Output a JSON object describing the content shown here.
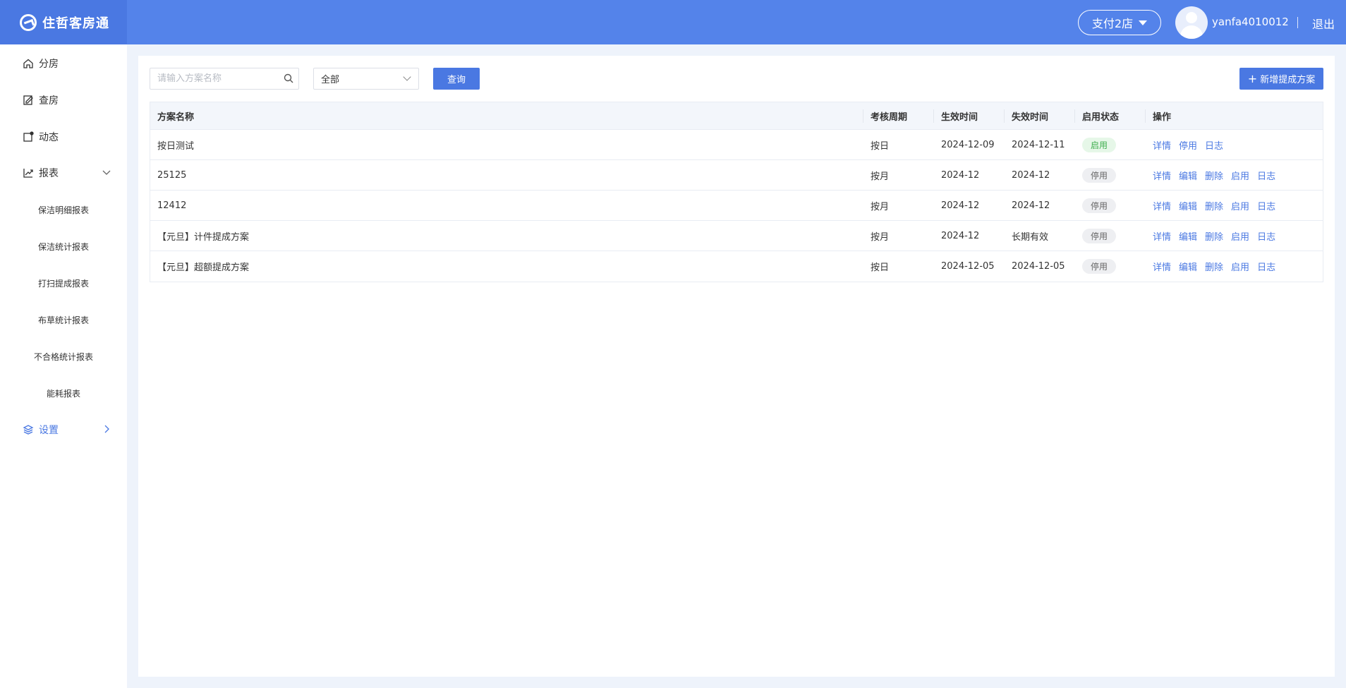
{
  "app": {
    "title": "住哲客房通"
  },
  "header": {
    "store": "支付2店",
    "username": "yanfa4010012",
    "logout": "退出"
  },
  "sidebar": {
    "items": [
      {
        "label": "分房",
        "icon": "home-icon"
      },
      {
        "label": "查房",
        "icon": "edit-note-icon"
      },
      {
        "label": "动态",
        "icon": "square-dot-icon"
      },
      {
        "label": "报表",
        "icon": "chart-up-icon",
        "expanded": true,
        "children": [
          "保洁明细报表",
          "保洁统计报表",
          "打扫提成报表",
          "布草统计报表",
          "不合格统计报表",
          "能耗报表"
        ]
      },
      {
        "label": "设置",
        "icon": "layers-icon",
        "active": true
      }
    ]
  },
  "toolbar": {
    "search_placeholder": "请输入方案名称",
    "select_value": "全部",
    "query_label": "查询",
    "add_label": "新增提成方案"
  },
  "table": {
    "columns": [
      "方案名称",
      "考核周期",
      "生效时间",
      "失效时间",
      "启用状态",
      "操作"
    ],
    "rows": [
      {
        "name": "按日测试",
        "period": "按日",
        "start": "2024-12-09",
        "end": "2024-12-11",
        "status": "启用",
        "status_color": "#3fae4e",
        "ops": [
          "详情",
          "停用",
          "日志"
        ]
      },
      {
        "name": "25125",
        "period": "按月",
        "start": "2024-12",
        "end": "2024-12",
        "status": "停用",
        "status_color": "#666666",
        "ops": [
          "详情",
          "编辑",
          "删除",
          "启用",
          "日志"
        ]
      },
      {
        "name": "12412",
        "period": "按月",
        "start": "2024-12",
        "end": "2024-12",
        "status": "停用",
        "status_color": "#666666",
        "ops": [
          "详情",
          "编辑",
          "删除",
          "启用",
          "日志"
        ]
      },
      {
        "name": "【元旦】计件提成方案",
        "period": "按月",
        "start": "2024-12",
        "end": "长期有效",
        "status": "停用",
        "status_color": "#666666",
        "ops": [
          "详情",
          "编辑",
          "删除",
          "启用",
          "日志"
        ]
      },
      {
        "name": "【元旦】超额提成方案",
        "period": "按日",
        "start": "2024-12-05",
        "end": "2024-12-05",
        "status": "停用",
        "status_color": "#666666",
        "ops": [
          "详情",
          "编辑",
          "删除",
          "启用",
          "日志"
        ]
      }
    ]
  },
  "colors": {
    "brand": "#5483ea",
    "accent": "#4a78e2",
    "page_bg": "#eef3fb"
  }
}
